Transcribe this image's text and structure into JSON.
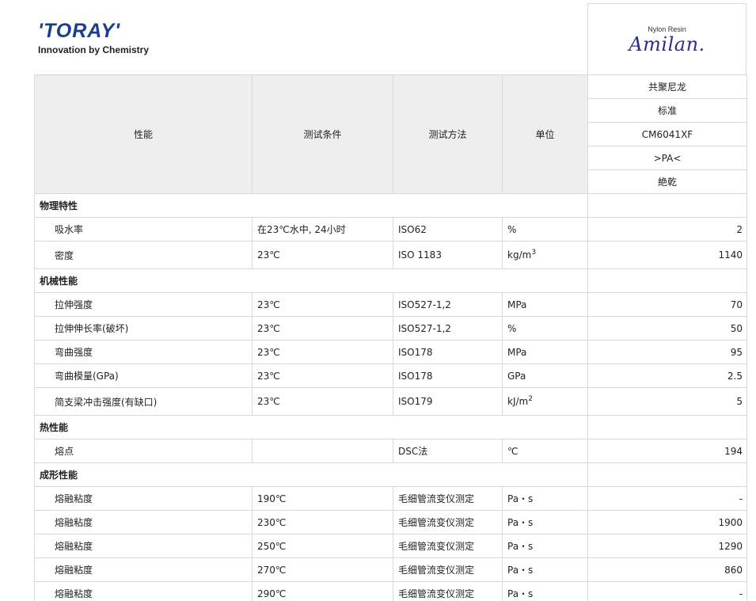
{
  "logo": {
    "name": "'TORAY'",
    "tagline": "Innovation by Chemistry"
  },
  "brand": {
    "subtitle": "Nylon Resin",
    "name": "Amilan."
  },
  "table": {
    "headers": {
      "property": "性能",
      "condition": "测试条件",
      "method": "测试方法",
      "unit": "单位"
    },
    "spec": [
      "共聚尼龙",
      "标准",
      "CM6041XF",
      ">PA<",
      "絶乾"
    ],
    "sections": [
      {
        "title": "物理特性",
        "rows": [
          {
            "property": "吸水率",
            "condition": "在23℃水中, 24小时",
            "method": "ISO62",
            "unit": "%",
            "unit_sup": "",
            "value": "2"
          },
          {
            "property": "密度",
            "condition": "23℃",
            "method": "ISO 1183",
            "unit": "kg/m",
            "unit_sup": "3",
            "value": "1140"
          }
        ]
      },
      {
        "title": "机械性能",
        "rows": [
          {
            "property": "拉伸强度",
            "condition": "23℃",
            "method": "ISO527-1,2",
            "unit": "MPa",
            "unit_sup": "",
            "value": "70"
          },
          {
            "property": "拉伸伸长率(破坏)",
            "condition": "23℃",
            "method": "ISO527-1,2",
            "unit": "%",
            "unit_sup": "",
            "value": "50"
          },
          {
            "property": "弯曲强度",
            "condition": "23℃",
            "method": "ISO178",
            "unit": "MPa",
            "unit_sup": "",
            "value": "95"
          },
          {
            "property": "弯曲模量(GPa)",
            "condition": "23℃",
            "method": "ISO178",
            "unit": "GPa",
            "unit_sup": "",
            "value": "2.5"
          },
          {
            "property": "简支梁冲击强度(有缺口)",
            "condition": "23℃",
            "method": "ISO179",
            "unit": "kJ/m",
            "unit_sup": "2",
            "value": "5"
          }
        ]
      },
      {
        "title": "热性能",
        "rows": [
          {
            "property": "熔点",
            "condition": "",
            "method": "DSC法",
            "unit": "℃",
            "unit_sup": "",
            "value": "194"
          }
        ]
      },
      {
        "title": "成形性能",
        "rows": [
          {
            "property": "熔融粘度",
            "condition": "190℃",
            "method": "毛细管流变仪测定",
            "unit": "Pa・s",
            "unit_sup": "",
            "value": "-"
          },
          {
            "property": "熔融粘度",
            "condition": "230℃",
            "method": "毛细管流变仪测定",
            "unit": "Pa・s",
            "unit_sup": "",
            "value": "1900"
          },
          {
            "property": "熔融粘度",
            "condition": "250℃",
            "method": "毛细管流变仪测定",
            "unit": "Pa・s",
            "unit_sup": "",
            "value": "1290"
          },
          {
            "property": "熔融粘度",
            "condition": "270℃",
            "method": "毛细管流变仪测定",
            "unit": "Pa・s",
            "unit_sup": "",
            "value": "860"
          },
          {
            "property": "熔融粘度",
            "condition": "290℃",
            "method": "毛细管流变仪测定",
            "unit": "Pa・s",
            "unit_sup": "",
            "value": "-"
          }
        ]
      }
    ]
  }
}
